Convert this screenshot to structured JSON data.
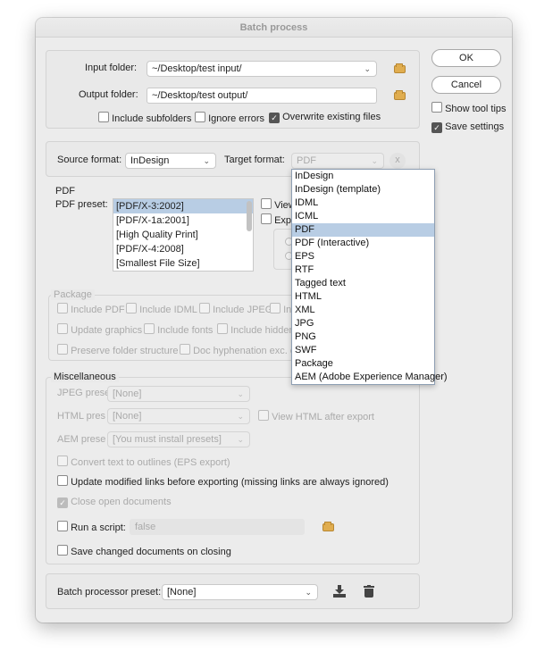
{
  "window": {
    "title": "Batch process"
  },
  "folders": {
    "input_label": "Input folder:",
    "input_value": "~/Desktop/test input/",
    "output_label": "Output folder:",
    "output_value": "~/Desktop/test output/",
    "include_subfolders": {
      "label": "Include subfolders",
      "checked": false
    },
    "ignore_errors": {
      "label": "Ignore errors",
      "checked": false
    },
    "overwrite": {
      "label": "Overwrite existing files",
      "checked": true
    }
  },
  "buttons": {
    "ok": "OK",
    "cancel": "Cancel"
  },
  "side_options": {
    "show_tool_tips": {
      "label": "Show tool tips",
      "checked": false
    },
    "save_settings": {
      "label": "Save settings",
      "checked": true
    }
  },
  "formats": {
    "source_label": "Source format:",
    "source_value": "InDesign",
    "target_label": "Target format:",
    "target_value": "PDF",
    "clear_label": "x",
    "dropdown_options": [
      "InDesign",
      "InDesign (template)",
      "IDML",
      "ICML",
      "PDF",
      "PDF (Interactive)",
      "EPS",
      "RTF",
      "Tagged text",
      "HTML",
      "XML",
      "JPG",
      "PNG",
      "SWF",
      "Package",
      "AEM (Adobe Experience Manager)"
    ],
    "dropdown_selected": "PDF"
  },
  "pdf": {
    "section_label": "PDF",
    "preset_label": "PDF preset:",
    "presets": [
      "[PDF/X-3:2002]",
      "[PDF/X-1a:2001]",
      "[High Quality Print]",
      "[PDF/X-4:2008]",
      "[Smallest File Size]"
    ],
    "selected_preset": "[PDF/X-3:2002]",
    "view_label": "View",
    "export_label": "Expo"
  },
  "package": {
    "section_label": "Package",
    "include_pdf": "Include PDF",
    "include_idml": "Include IDML",
    "include_jpeg": "Include JPEG",
    "include_more": "In",
    "update_graphics": "Update graphics",
    "include_fonts": "Include fonts",
    "include_hidden": "Include hidden",
    "preserve_structure": "Preserve folder structure",
    "doc_hyphenation": "Doc hyphenation exc. on"
  },
  "misc": {
    "section_label": "Miscellaneous",
    "jpeg_label": "JPEG prese",
    "jpeg_value": "[None]",
    "html_label": "HTML pres",
    "html_value": "[None]",
    "view_html": "View HTML after export",
    "aem_label": "AEM prese",
    "aem_value": "[You must install presets]",
    "convert_text": "Convert text to outlines (EPS export)",
    "update_links": "Update modified links before exporting (missing links are always ignored)",
    "close_docs": "Close open documents",
    "run_script_label": "Run a script:",
    "run_script_value": "false",
    "save_changed": "Save changed documents on closing"
  },
  "preset": {
    "label": "Batch processor preset:",
    "value": "[None]"
  },
  "colors": {
    "highlight": "#b8cde4",
    "folder": "#e0ad4f",
    "window": "#ececec"
  }
}
